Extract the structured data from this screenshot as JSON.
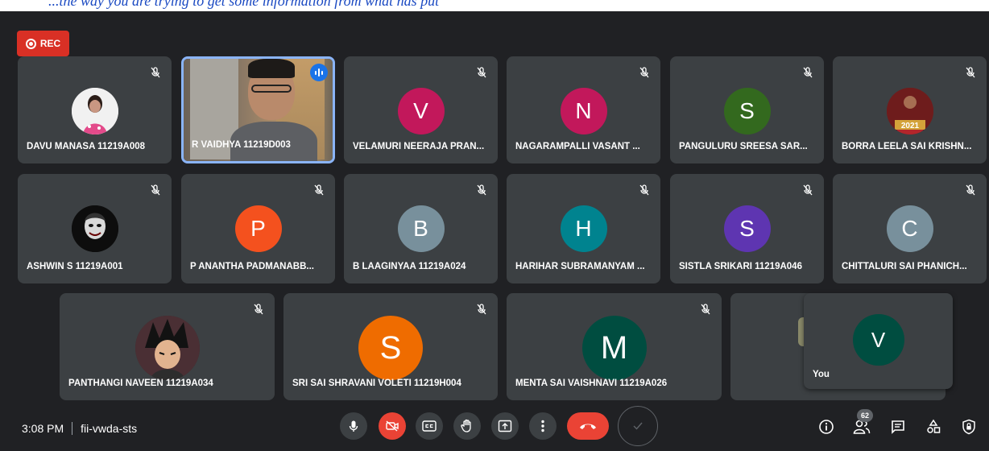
{
  "caption": "...the way you are trying to get some information from what has put",
  "recording": {
    "label": "REC"
  },
  "participants": [
    {
      "name": "DAVU MANASA 11219A008",
      "avatar": "photo",
      "icon": "portrait-photo"
    },
    {
      "name": "R VAIDHYA 11219D003",
      "avatar": "video",
      "speaking": true
    },
    {
      "name": "VELAMURI NEERAJA PRAN...",
      "avatar": "V",
      "color": "#c2185b"
    },
    {
      "name": "NAGARAMPALLI VASANT ...",
      "avatar": "N",
      "color": "#c2185b"
    },
    {
      "name": "PANGULURU SREESA SAR...",
      "avatar": "S",
      "color": "#33691e"
    },
    {
      "name": "BORRA LEELA SAI KRISHN...",
      "avatar": "photo",
      "icon": "cricket-2021-photo",
      "photo_text": "2021"
    },
    {
      "name": "ASHWIN S 11219A001",
      "avatar": "photo",
      "icon": "joker-photo"
    },
    {
      "name": "P ANANTHA PADMANABB...",
      "avatar": "P",
      "color": "#f4511e"
    },
    {
      "name": "B LAAGINYAA 11219A024",
      "avatar": "B",
      "color": "#78909c"
    },
    {
      "name": "HARIHAR SUBRAMANYAM ...",
      "avatar": "H",
      "color": "#00838f"
    },
    {
      "name": "SISTLA SRIKARI 11219A046",
      "avatar": "S",
      "color": "#5e35b1"
    },
    {
      "name": "CHITTALURI SAI PHANICH...",
      "avatar": "C",
      "color": "#78909c"
    },
    {
      "name": "PANTHANGI NAVEEN 11219A034",
      "avatar": "photo",
      "icon": "anime-photo"
    },
    {
      "name": "SRI SAI SHRAVANI VOLETI 11219H004",
      "avatar": "S",
      "color": "#ef6c00"
    },
    {
      "name": "MENTA SAI VAISHNAVI 11219A026",
      "avatar": "M",
      "color": "#004d40"
    }
  ],
  "self": {
    "name": "You",
    "avatar": "V",
    "color": "#004d40"
  },
  "meeting": {
    "time": "3:08 PM",
    "code": "fii-vwda-sts"
  },
  "people_count": "62",
  "colors": {
    "background": "#202124",
    "tile": "#3c4043",
    "accent": "#8ab4f8",
    "danger": "#ea4335"
  }
}
